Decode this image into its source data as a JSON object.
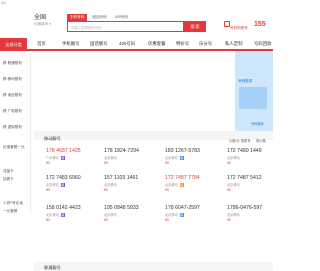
{
  "top_strip": "4D",
  "header": {
    "city": "全国",
    "city_sub": "切换城市 ▾",
    "search_tabs": [
      "手机号码",
      "固话号码",
      "400号码"
    ],
    "search_placeholder": "请输入您想找的号码",
    "search_button": "搜 索",
    "cart_label": "号码购物车",
    "phone": "155"
  },
  "nav": {
    "category": "全部分类",
    "items": [
      "首页",
      "手机靓号",
      "固话靓号",
      "400号码",
      "优惠套餐",
      "特价号",
      "乐分号",
      "私人定制",
      "号码回收"
    ]
  },
  "sidebar": {
    "items": [
      "移 联通靓号",
      "移 移动靓号",
      "移 电信靓号",
      "移 广电靓号",
      "移 虚拟靓号"
    ],
    "extra": [
      "优惠套餐一元",
      "流量卡",
      "话费卡",
      "少钱7号必读",
      "一元套餐"
    ]
  },
  "banner": {
    "caption": "号码投資",
    "subcaption": "号码管家"
  },
  "section1": {
    "title": "移动靓号",
    "filters": [
      "价格/元",
      "按尾号",
      "按价格"
    ]
  },
  "cards": [
    {
      "number": "178 4687 1495",
      "red": true,
      "city": "广州移动",
      "price": "¥0",
      "tag": "靓",
      "tagColor": "purple"
    },
    {
      "number": "178 1824-7294",
      "red": false,
      "city": "北京移动",
      "price": "¥0",
      "tag": "",
      "tagColor": ""
    },
    {
      "number": "183 1267-5783",
      "red": false,
      "city": "北京移动",
      "price": "¥0",
      "tag": "靓",
      "tagColor": "blue"
    },
    {
      "number": "172 7480 1449",
      "red": false,
      "city": "北京移动",
      "price": "¥0",
      "tag": "",
      "tagColor": ""
    },
    {
      "number": "172 7483 6960",
      "red": false,
      "city": "北京移动",
      "price": "¥0",
      "tag": "靓",
      "tagColor": "purple"
    },
    {
      "number": "157 1103 1461",
      "red": false,
      "city": "北京移动",
      "price": "¥0",
      "tag": "",
      "tagColor": ""
    },
    {
      "number": "172 7487 7784",
      "red": true,
      "city": "北京移动",
      "price": "¥0",
      "tag": "靓",
      "tagColor": "orange"
    },
    {
      "number": "172 7487 5412",
      "red": false,
      "city": "北京移动",
      "price": "¥0",
      "tag": "",
      "tagColor": ""
    },
    {
      "number": "158 0142 4423",
      "red": false,
      "city": "北京移动",
      "price": "¥0",
      "tag": "靓",
      "tagColor": "purple"
    },
    {
      "number": "195 0848 5933",
      "red": false,
      "city": "北京移动",
      "price": "¥0",
      "tag": "",
      "tagColor": ""
    },
    {
      "number": "178 6047-2597",
      "red": false,
      "city": "北京移动",
      "price": "¥0",
      "tag": "靓",
      "tagColor": "blue"
    },
    {
      "number": "1786-0476-597",
      "red": false,
      "city": "北京移动",
      "price": "¥0",
      "tag": "",
      "tagColor": ""
    }
  ],
  "section2": {
    "title": "联通靓号"
  }
}
